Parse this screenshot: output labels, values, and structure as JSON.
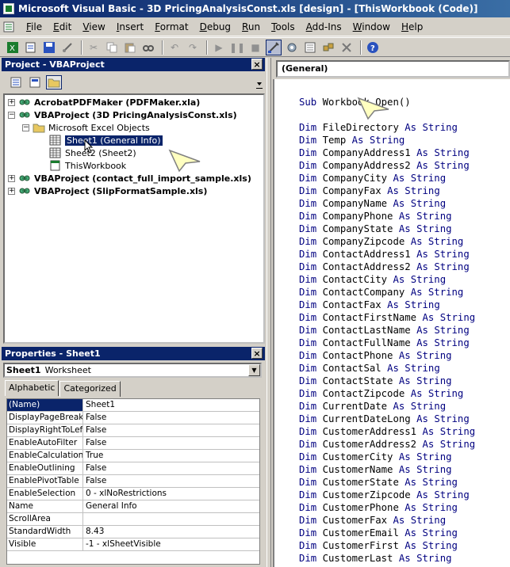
{
  "window": {
    "title": "Microsoft Visual Basic - 3D PricingAnalysisConst.xls [design] - [ThisWorkbook (Code)]"
  },
  "menubar": {
    "items": [
      "File",
      "Edit",
      "View",
      "Insert",
      "Format",
      "Debug",
      "Run",
      "Tools",
      "Add-Ins",
      "Window",
      "Help"
    ]
  },
  "toolbar": {
    "icons": [
      "excel-icon",
      "insert-module-icon",
      "save-icon",
      "cut-icon",
      "copy-icon",
      "paste-icon",
      "find-icon",
      "undo-icon",
      "redo-icon",
      "run-icon",
      "break-icon",
      "reset-icon",
      "design-mode-icon",
      "project-explorer-icon",
      "properties-icon",
      "object-browser-icon",
      "toolbox-icon",
      "help-icon"
    ]
  },
  "project_panel": {
    "title": "Project - VBAProject",
    "close_label": "×",
    "tree": [
      {
        "label": "AcrobatPDFMaker (PDFMaker.xla)",
        "bold": true,
        "expander": "+"
      },
      {
        "label": "VBAProject (3D PricingAnalysisConst.xls)",
        "bold": true,
        "expander": "−"
      },
      {
        "label": "Microsoft Excel Objects",
        "bold": false,
        "expander": "−"
      },
      {
        "label": "Sheet1 (General Info)",
        "bold": false,
        "selected": true
      },
      {
        "label": "Sheet2 (Sheet2)",
        "bold": false
      },
      {
        "label": "ThisWorkbook",
        "bold": false
      },
      {
        "label": "VBAProject (contact_full_import_sample.xls)",
        "bold": true,
        "expander": "+"
      },
      {
        "label": "VBAProject (SlipFormatSample.xls)",
        "bold": true,
        "expander": "+"
      }
    ]
  },
  "properties_panel": {
    "title": "Properties - Sheet1",
    "close_label": "×",
    "object_name": "Sheet1",
    "object_type": "Worksheet",
    "tabs": [
      "Alphabetic",
      "Categorized"
    ],
    "rows": [
      {
        "name": "(Name)",
        "value": "Sheet1"
      },
      {
        "name": "DisplayPageBreaks",
        "value": "False"
      },
      {
        "name": "DisplayRightToLeft",
        "value": "False"
      },
      {
        "name": "EnableAutoFilter",
        "value": "False"
      },
      {
        "name": "EnableCalculation",
        "value": "True"
      },
      {
        "name": "EnableOutlining",
        "value": "False"
      },
      {
        "name": "EnablePivotTable",
        "value": "False"
      },
      {
        "name": "EnableSelection",
        "value": "0 - xlNoRestrictions"
      },
      {
        "name": "Name",
        "value": "General Info"
      },
      {
        "name": "ScrollArea",
        "value": ""
      },
      {
        "name": "StandardWidth",
        "value": "8.43"
      },
      {
        "name": "Visible",
        "value": "-1 - xlSheetVisible"
      }
    ]
  },
  "code_window": {
    "object_combo": "(General)",
    "header": {
      "kw": "Sub",
      "name": "Workbook_Open()"
    },
    "declarations": [
      "FileDirectory",
      "Temp",
      "CompanyAddress1",
      "CompanyAddress2",
      "CompanyCity",
      "CompanyFax",
      "CompanyName",
      "CompanyPhone",
      "CompanyState",
      "CompanyZipcode",
      "ContactAddress1",
      "ContactAddress2",
      "ContactCity",
      "ContactCompany",
      "ContactFax",
      "ContactFirstName",
      "ContactLastName",
      "ContactFullName",
      "ContactPhone",
      "ContactSal",
      "ContactState",
      "ContactZipcode",
      "CurrentDate",
      "CurrentDateLong",
      "CustomerAddress1",
      "CustomerAddress2",
      "CustomerCity",
      "CustomerName",
      "CustomerState",
      "CustomerZipcode",
      "CustomerPhone",
      "CustomerFax",
      "CustomerEmail",
      "CustomerFirst",
      "CustomerLast"
    ],
    "kw_dim": "Dim",
    "kw_as": "As",
    "kw_type": "String"
  },
  "colors": {
    "titlebar": "#0a246a",
    "keyword": "#000080",
    "callout": "#ffffc0"
  }
}
